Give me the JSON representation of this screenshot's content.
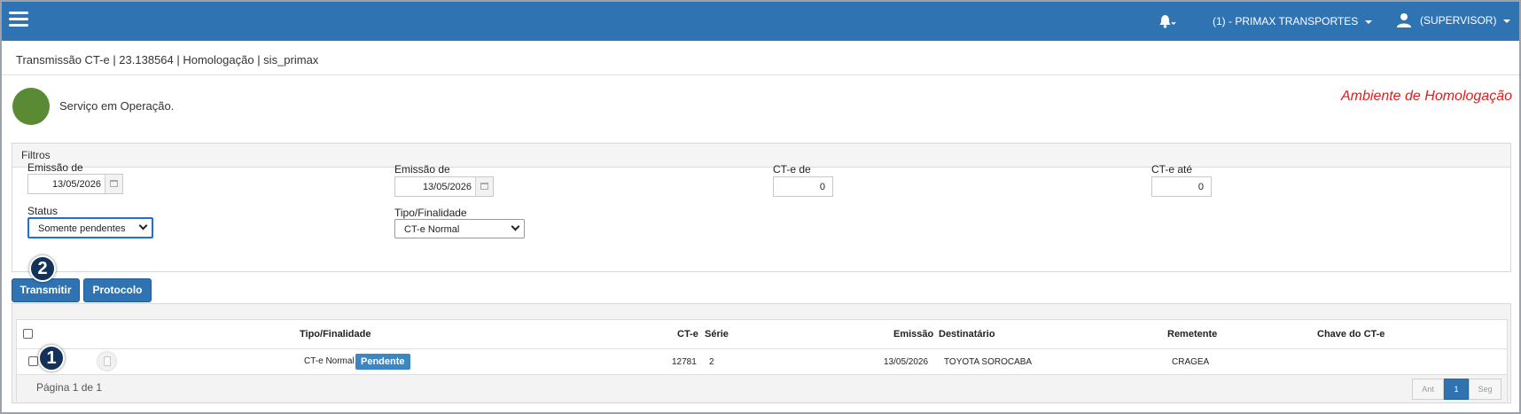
{
  "topbar": {
    "company": "(1) - PRIMAX TRANSPORTES",
    "user": "(SUPERVISOR)"
  },
  "breadcrumb": "Transmissão CT-e | 23.138564 | Homologação | sis_primax",
  "status": {
    "text": "Serviço em Operação.",
    "color": "#5b8a35",
    "ambiente": "Ambiente de Homologação"
  },
  "filters": {
    "title": "Filtros",
    "emissao_de_1": {
      "label": "Emissão de",
      "value": "13/05/2026"
    },
    "emissao_de_2": {
      "label": "Emissão de",
      "value": "13/05/2026"
    },
    "cte_de": {
      "label": "CT-e de",
      "value": "0"
    },
    "cte_ate": {
      "label": "CT-e até",
      "value": "0"
    },
    "status": {
      "label": "Status",
      "value": "Somente pendentes"
    },
    "tipo": {
      "label": "Tipo/Finalidade",
      "value": "CT-e Normal"
    }
  },
  "actions": {
    "transmitir": "Transmitir",
    "protocolo": "Protocolo"
  },
  "badges": {
    "one": "1",
    "two": "2"
  },
  "grid": {
    "headers": {
      "tipo": "Tipo/Finalidade",
      "cte": "CT-e",
      "serie": "Série",
      "emissao": "Emissão",
      "destinatario": "Destinatário",
      "remetente": "Remetente",
      "chave": "Chave do CT-e"
    },
    "rows": [
      {
        "tipo": "CT-e Normal",
        "status_badge": "Pendente",
        "cte": "12781",
        "serie": "2",
        "emissao": "13/05/2026",
        "destinatario": "TOYOTA SOROCABA",
        "remetente": "CRAGEA",
        "chave": ""
      }
    ],
    "pager": {
      "text": "Página 1 de 1",
      "prev": "Ant",
      "current": "1",
      "next": "Seg"
    }
  }
}
